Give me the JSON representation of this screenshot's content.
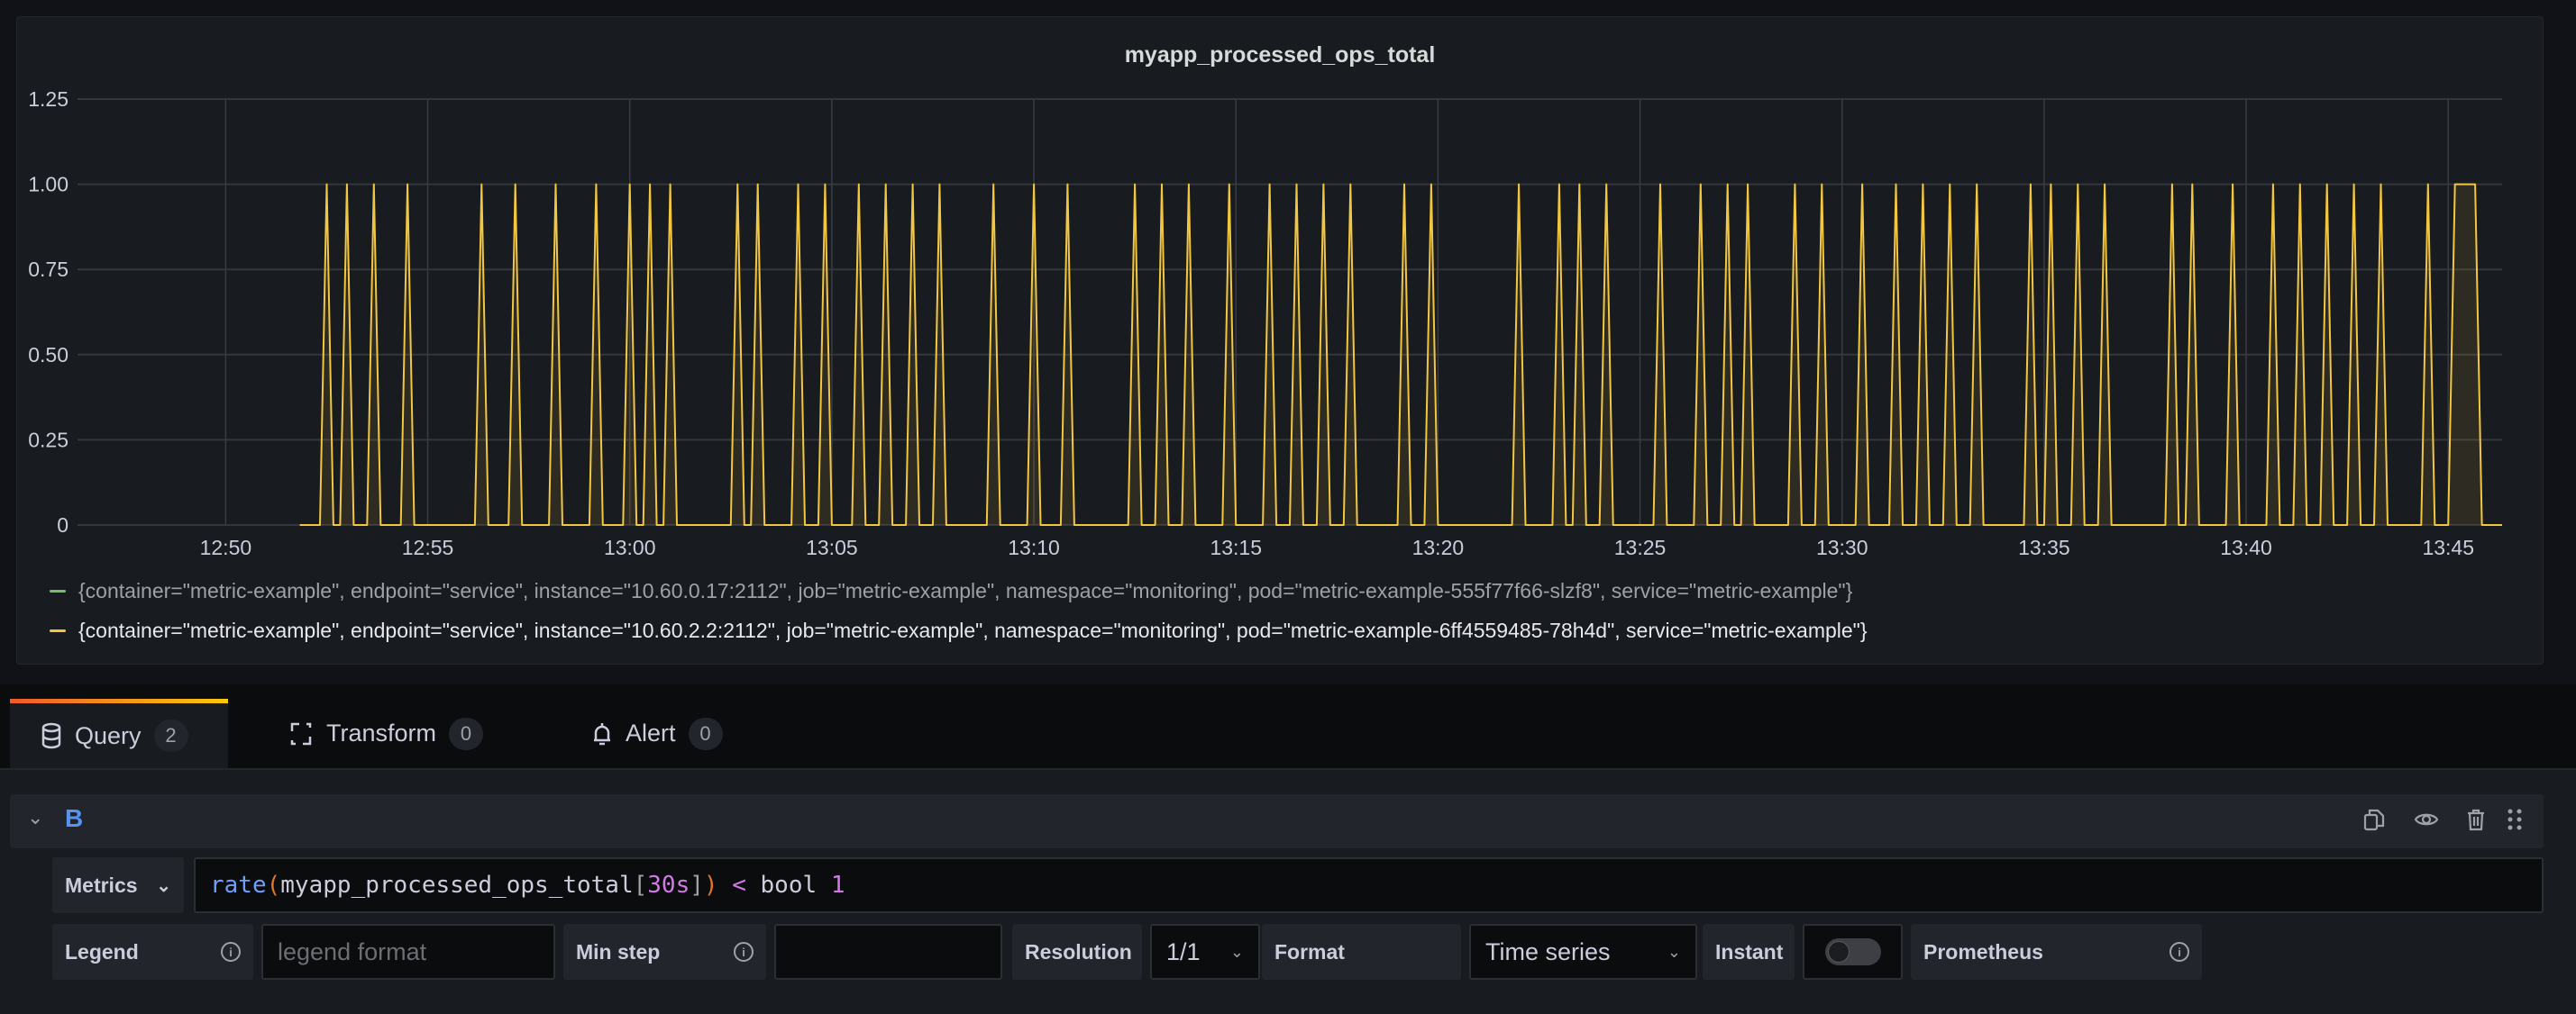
{
  "panel": {
    "title": "myapp_processed_ops_total",
    "legend": [
      {
        "label": "{container=\"metric-example\", endpoint=\"service\", instance=\"10.60.0.17:2112\", job=\"metric-example\", namespace=\"monitoring\", pod=\"metric-example-555f77f66-slzf8\", service=\"metric-example\"}",
        "color": "#73bf69",
        "text_color": "#9fa1a7"
      },
      {
        "label": "{container=\"metric-example\", endpoint=\"service\", instance=\"10.60.2.2:2112\", job=\"metric-example\", namespace=\"monitoring\", pod=\"metric-example-6ff4559485-78h4d\", service=\"metric-example\"}",
        "color": "#f2c641",
        "text_color": "#e8e8ee"
      }
    ]
  },
  "chart_data": {
    "type": "line",
    "title": "myapp_processed_ops_total",
    "xlim": [
      "12:46:20",
      "13:46:20"
    ],
    "ylim": [
      0,
      1.25
    ],
    "grid": true,
    "legend_placement": "bottom",
    "x_ticks": [
      "12:50",
      "12:55",
      "13:00",
      "13:05",
      "13:10",
      "13:15",
      "13:20",
      "13:25",
      "13:30",
      "13:35",
      "13:40",
      "13:45"
    ],
    "y_ticks": [
      {
        "v": 0,
        "label": "0"
      },
      {
        "v": 0.25,
        "label": "0.25"
      },
      {
        "v": 0.5,
        "label": "0.50"
      },
      {
        "v": 0.75,
        "label": "0.75"
      },
      {
        "v": 1,
        "label": "1.00"
      },
      {
        "v": 1.25,
        "label": "1.25"
      }
    ],
    "series": [
      {
        "name": "{container=\"metric-example\", endpoint=\"service\", instance=\"10.60.0.17:2112\", job=\"metric-example\", namespace=\"monitoring\", pod=\"metric-example-555f77f66-slzf8\", service=\"metric-example\"}",
        "color": "#73bf69",
        "points_shown": false
      },
      {
        "name": "{container=\"metric-example\", endpoint=\"service\", instance=\"10.60.2.2:2112\", job=\"metric-example\", namespace=\"monitoring\", pod=\"metric-example-6ff4559485-78h4d\", service=\"metric-example\"}",
        "color": "#f2c641",
        "range": [
          "12:51:50",
          "13:46:20"
        ],
        "default_value": 0,
        "value_1_at": [
          "12:52:30",
          "12:53:00",
          "12:53:40",
          "12:54:30",
          "12:56:20",
          "12:57:10",
          "12:58:10",
          "12:59:10",
          "13:00:00",
          "13:00:30",
          "13:01:00",
          "13:02:40",
          "13:03:10",
          "13:04:10",
          "13:04:50",
          "13:05:40",
          "13:06:20",
          "13:07:00",
          "13:07:40",
          "13:09:00",
          "13:10:00",
          "13:10:50",
          "13:12:30",
          "13:13:10",
          "13:13:50",
          "13:14:50",
          "13:15:50",
          "13:16:30",
          "13:17:10",
          "13:17:50",
          "13:19:10",
          "13:19:50",
          "13:22:00",
          "13:23:00",
          "13:23:30",
          "13:24:10",
          "13:25:30",
          "13:26:30",
          "13:27:10",
          "13:27:40",
          "13:28:50",
          "13:29:30",
          "13:30:30",
          "13:31:20",
          "13:32:00",
          "13:32:40",
          "13:33:20",
          "13:34:40",
          "13:35:10",
          "13:35:50",
          "13:36:30",
          "13:38:10",
          "13:38:40",
          "13:39:40",
          "13:40:40",
          "13:41:20",
          "13:42:00",
          "13:42:40",
          "13:43:20",
          "13:44:30",
          "13:45:10",
          "13:45:20",
          "13:45:30",
          "13:45:40"
        ]
      }
    ]
  },
  "tabs": [
    {
      "label": "Query",
      "count": "2",
      "icon": "database-icon"
    },
    {
      "label": "Transform",
      "count": "0",
      "icon": "transform-icon"
    },
    {
      "label": "Alert",
      "count": "0",
      "icon": "bell-icon"
    }
  ],
  "query": {
    "ref_id": "B",
    "metrics_label": "Metrics",
    "expression_tokens": [
      {
        "t": "rate",
        "c": "#6e9fff"
      },
      {
        "t": "(",
        "c": "#e0752d"
      },
      {
        "t": "myapp_processed_ops_total",
        "c": "#ccccdc"
      },
      {
        "t": "[",
        "c": "#9fa1a7"
      },
      {
        "t": "30s",
        "c": "#d17ae6"
      },
      {
        "t": "]",
        "c": "#9fa1a7"
      },
      {
        "t": ")",
        "c": "#e0752d"
      },
      {
        "t": " < ",
        "c": "#d17ae6"
      },
      {
        "t": "bool ",
        "c": "#ccccdc"
      },
      {
        "t": "1",
        "c": "#d17ae6"
      }
    ],
    "legend_label": "Legend",
    "legend_placeholder": "legend format",
    "min_step_label": "Min step",
    "min_step_value": "",
    "resolution_label": "Resolution",
    "resolution_value": "1/1",
    "format_label": "Format",
    "format_value": "Time series",
    "instant_label": "Instant",
    "instant_on": false,
    "datasource_label": "Prometheus"
  }
}
